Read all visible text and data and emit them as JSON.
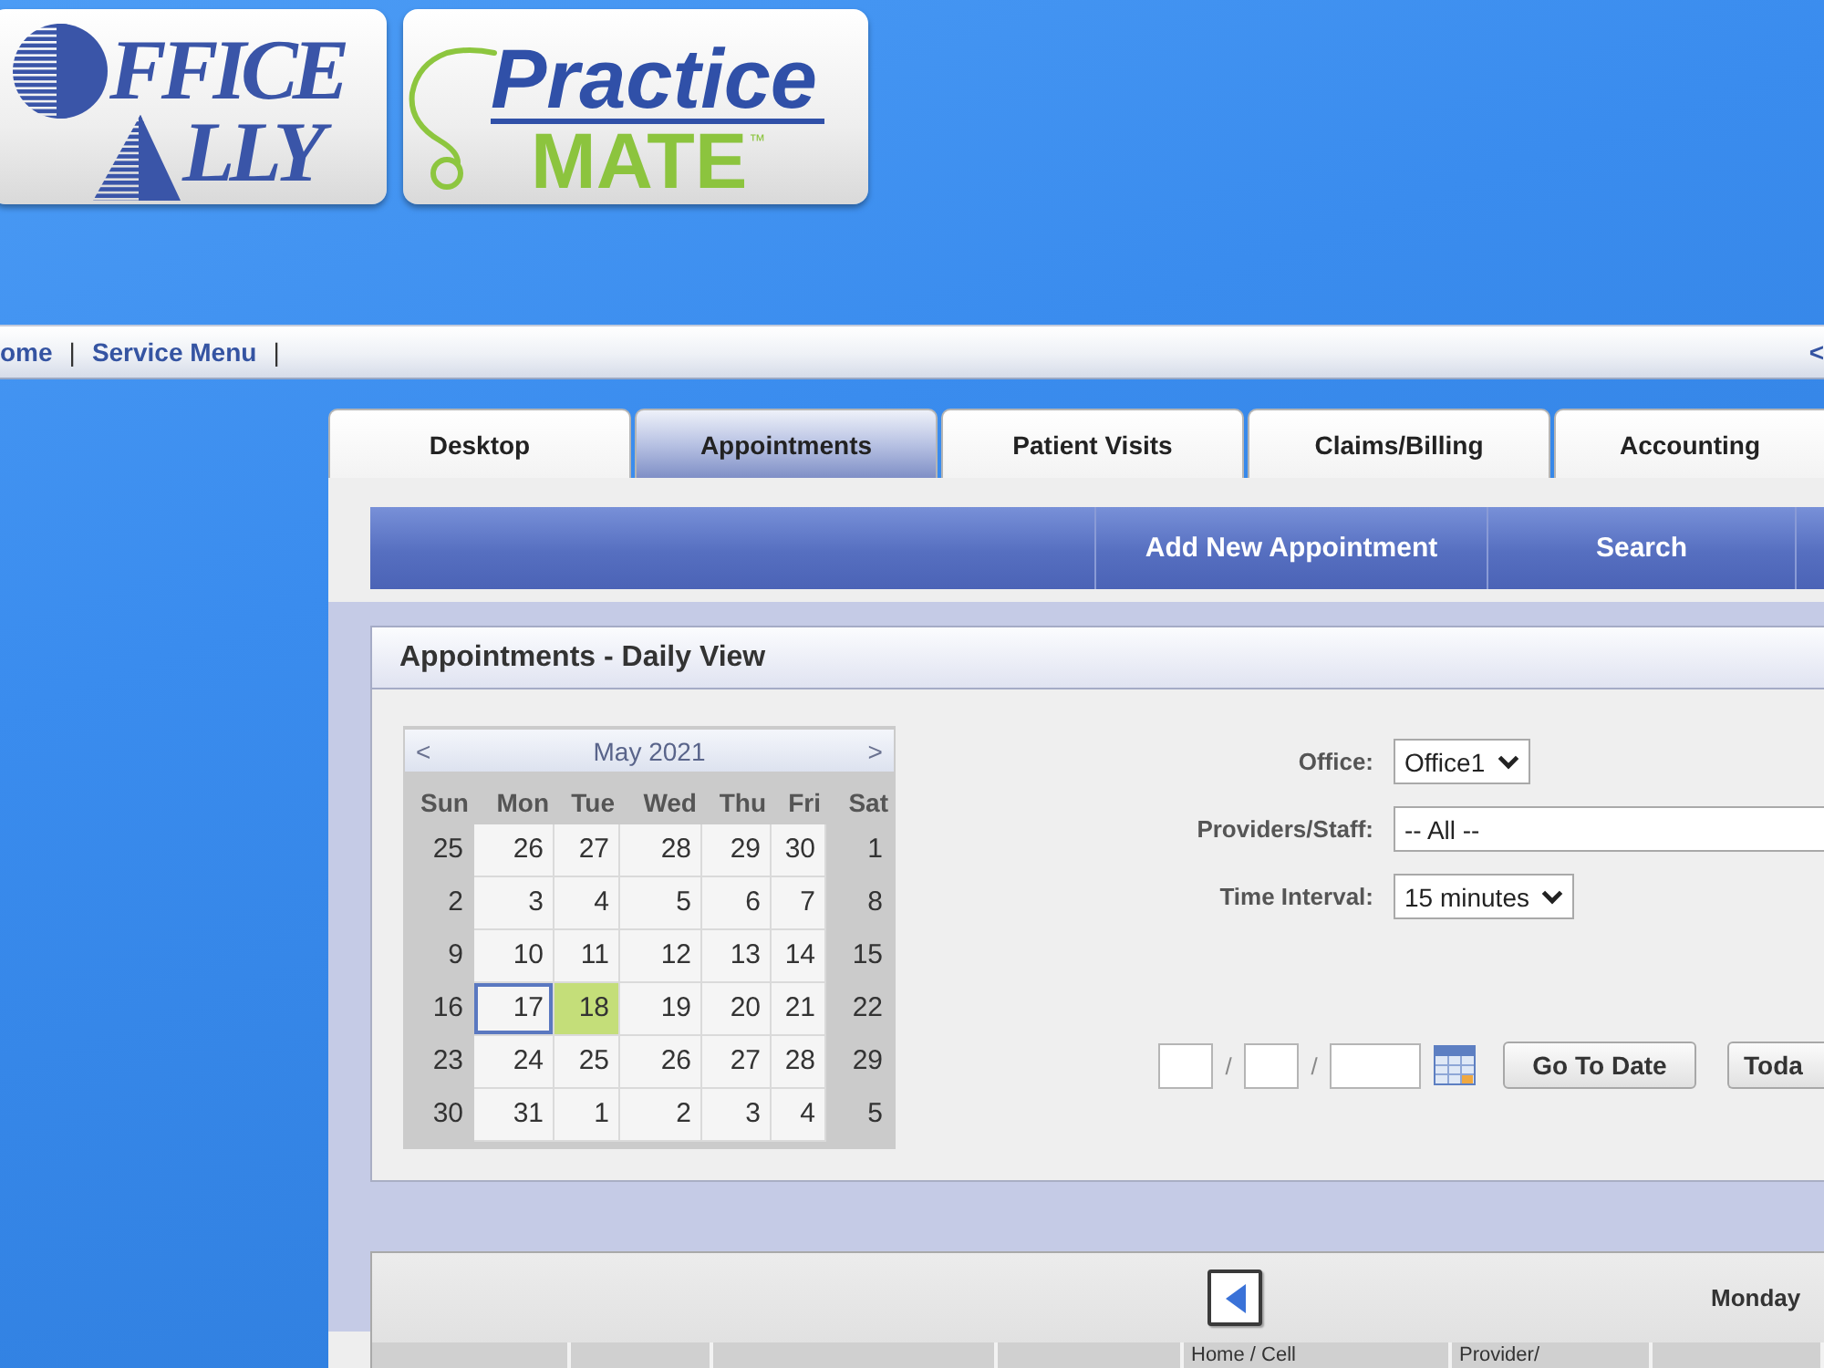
{
  "logos": [
    {
      "kind": "office_ally",
      "top_text": "FFICE",
      "bottom_text": "LLY"
    },
    {
      "kind": "practice_mate",
      "top_text": "Practice",
      "bottom_text": "MATE",
      "trademark": "™"
    }
  ],
  "nav_bar": {
    "items": [
      {
        "label": "ome",
        "separator": "|"
      },
      {
        "label": "Service Menu",
        "separator": "|"
      }
    ],
    "end_text": "<"
  },
  "tabs": [
    {
      "label": "Desktop",
      "selected": false
    },
    {
      "label": "Appointments",
      "selected": true
    },
    {
      "label": "Patient Visits",
      "selected": false
    },
    {
      "label": "Claims/Billing",
      "selected": false
    },
    {
      "label": "Accounting",
      "selected": false
    }
  ],
  "toolbar": {
    "buttons": [
      "Add New Appointment",
      "Search"
    ]
  },
  "daily_view": {
    "title": "Appointments - Daily View",
    "calendar": {
      "prev": "<",
      "month": "May 2021",
      "next": ">",
      "weekdays": [
        "Sun",
        "Mon",
        "Tue",
        "Wed",
        "Thu",
        "Fri",
        "Sat"
      ],
      "weeks": [
        [
          {
            "day": "25",
            "today": false,
            "selected": false
          },
          {
            "day": "26",
            "today": false,
            "selected": false
          },
          {
            "day": "27",
            "today": false,
            "selected": false
          },
          {
            "day": "28",
            "today": false,
            "selected": false
          },
          {
            "day": "29",
            "today": false,
            "selected": false
          },
          {
            "day": "30",
            "today": false,
            "selected": false
          },
          {
            "day": "1",
            "today": false,
            "selected": false
          }
        ],
        [
          {
            "day": "2",
            "today": false,
            "selected": false
          },
          {
            "day": "3",
            "today": false,
            "selected": false
          },
          {
            "day": "4",
            "today": false,
            "selected": false
          },
          {
            "day": "5",
            "today": false,
            "selected": false
          },
          {
            "day": "6",
            "today": false,
            "selected": false
          },
          {
            "day": "7",
            "today": false,
            "selected": false
          },
          {
            "day": "8",
            "today": false,
            "selected": false
          }
        ],
        [
          {
            "day": "9",
            "today": false,
            "selected": false
          },
          {
            "day": "10",
            "today": false,
            "selected": false
          },
          {
            "day": "11",
            "today": false,
            "selected": false
          },
          {
            "day": "12",
            "today": false,
            "selected": false
          },
          {
            "day": "13",
            "today": false,
            "selected": false
          },
          {
            "day": "14",
            "today": false,
            "selected": false
          },
          {
            "day": "15",
            "today": false,
            "selected": false
          }
        ],
        [
          {
            "day": "16",
            "today": false,
            "selected": false
          },
          {
            "day": "17",
            "today": true,
            "selected": false
          },
          {
            "day": "18",
            "today": false,
            "selected": true
          },
          {
            "day": "19",
            "today": false,
            "selected": false
          },
          {
            "day": "20",
            "today": false,
            "selected": false
          },
          {
            "day": "21",
            "today": false,
            "selected": false
          },
          {
            "day": "22",
            "today": false,
            "selected": false
          }
        ],
        [
          {
            "day": "23",
            "today": false,
            "selected": false
          },
          {
            "day": "24",
            "today": false,
            "selected": false
          },
          {
            "day": "25",
            "today": false,
            "selected": false
          },
          {
            "day": "26",
            "today": false,
            "selected": false
          },
          {
            "day": "27",
            "today": false,
            "selected": false
          },
          {
            "day": "28",
            "today": false,
            "selected": false
          },
          {
            "day": "29",
            "today": false,
            "selected": false
          }
        ],
        [
          {
            "day": "30",
            "today": false,
            "selected": false
          },
          {
            "day": "31",
            "today": false,
            "selected": false
          },
          {
            "day": "1",
            "today": false,
            "selected": false
          },
          {
            "day": "2",
            "today": false,
            "selected": false
          },
          {
            "day": "3",
            "today": false,
            "selected": false
          },
          {
            "day": "4",
            "today": false,
            "selected": false
          },
          {
            "day": "5",
            "today": false,
            "selected": false
          }
        ]
      ]
    },
    "fields": [
      {
        "kind": "dropdown",
        "label": "Office:",
        "value": "Office1"
      },
      {
        "kind": "listbox",
        "label": "Providers/Staff:",
        "value": "-- All --"
      },
      {
        "kind": "dropdown",
        "label": "Time Interval:",
        "value": "15 minutes"
      }
    ],
    "date_inputs": [
      {
        "kind": "month",
        "separator": "/"
      },
      {
        "kind": "day",
        "separator": "/"
      },
      {
        "kind": "year"
      }
    ],
    "buttons": [
      "Go To Date",
      "Toda"
    ]
  },
  "schedule": {
    "day_label": "Monday",
    "columns": [
      {
        "kind": "blank"
      },
      {
        "kind": "blank"
      },
      {
        "kind": "blank"
      },
      {
        "kind": "blank"
      },
      {
        "kind": "text",
        "label": "Home / Cell"
      },
      {
        "kind": "text",
        "label": "Provider/"
      },
      {
        "kind": "blank"
      }
    ]
  }
}
